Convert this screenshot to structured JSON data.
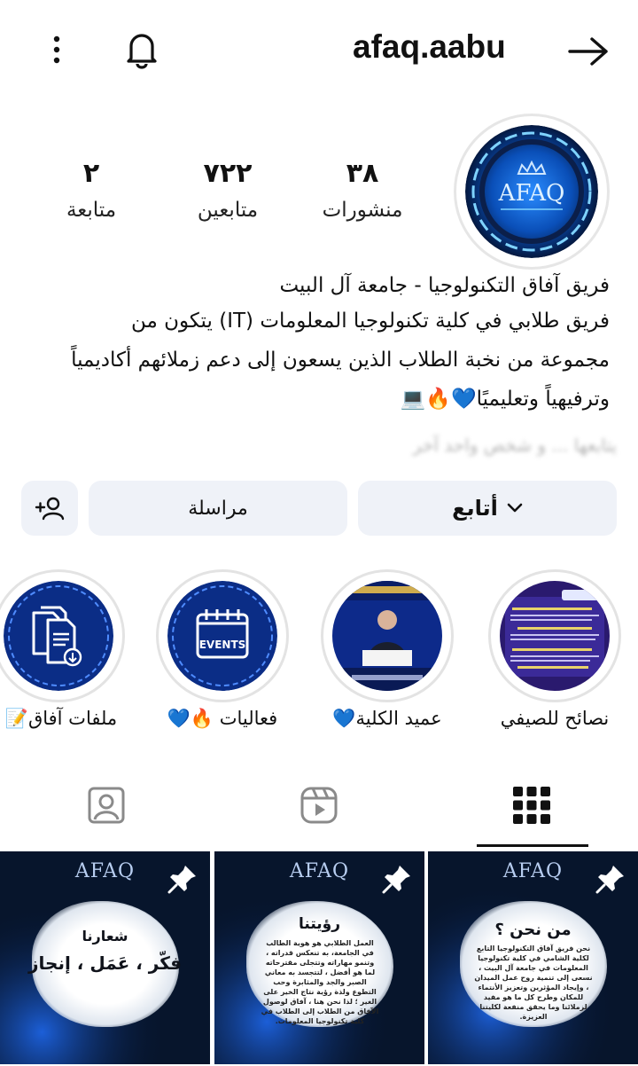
{
  "header": {
    "username": "afaq.aabu",
    "more_icon": "more-vertical-icon",
    "bell_icon": "bell-icon",
    "back_icon": "arrow-right-icon"
  },
  "profile": {
    "avatar_logo_text": "AFAQ",
    "stats": [
      {
        "value": "٣٨",
        "label": "منشورات"
      },
      {
        "value": "٧٢٢",
        "label": "متابعين"
      },
      {
        "value": "٢",
        "label": "متابعة"
      }
    ]
  },
  "bio": {
    "line1": "فريق آفاق التكنولوجيا - جامعة آل البيت",
    "line2": "فريق طلابي في كلية تكنولوجيا المعلومات (IT) يتكون من",
    "line3": "مجموعة من نخبة الطلاب الذين يسعون إلى دعم زملائهم أكاديمياً",
    "line4": "وترفيهياً وتعليميًا💙🔥💻",
    "followed_by": "يتابعها ... و شخص واحد آخر"
  },
  "actions": {
    "follow_label": "أتابع",
    "message_label": "مراسلة",
    "add_user_icon": "add-user-icon"
  },
  "highlights": [
    {
      "label": "نصائح للصيفي"
    },
    {
      "label": "عميد الكلية💙"
    },
    {
      "label": "فعاليات 🔥💙",
      "events_text": "EVENTS"
    },
    {
      "label": "ملفات آفاق📝"
    }
  ],
  "tabs": [
    {
      "name": "grid-icon",
      "active": true
    },
    {
      "name": "reels-icon",
      "active": false
    },
    {
      "name": "tagged-icon",
      "active": false
    }
  ],
  "posts": [
    {
      "logo": "AFAQ",
      "title": "من نحن ؟",
      "text": "نحن فريق آفاق التكنولوجيا التابع لكلية الشامي في كلية تكنولوجيا المعلومات في جامعة آل البيت ، نسعى إلى تنمية روح عمل الميدان ، وإيجاد المؤثرين وتعزيز الأنتماء للمكان وطرح كل ما هو مفيد لزملائنا وما يحقق منفعة لكليتنا العزيزة."
    },
    {
      "logo": "AFAQ",
      "title": "رؤيتنا",
      "text": "العمل الطلابي هو هوية الطالب في الجامعة، به تنعكس قدراته ، وتنمو مهاراته وتتجلى مقترحاته لما هو أفضل ، لتتجسد به معاني الصبر والجد والمثابرة وحب التطوع ولذة رؤية نتاج الخير على الغير ؛ لذا نحن هنا ، آفاق لوصول الآفاق من الطلاب إلى الطلاب في كلية تكنولوجيا المعلومات."
    },
    {
      "logo": "AFAQ",
      "title": "شعارنا",
      "slogan": "فكّر ، عَمَل ، إنجاز"
    }
  ],
  "colors": {
    "button_bg": "#eff2f8",
    "brand_blue": "#1c6fe0",
    "dark_navy": "#07152c"
  }
}
